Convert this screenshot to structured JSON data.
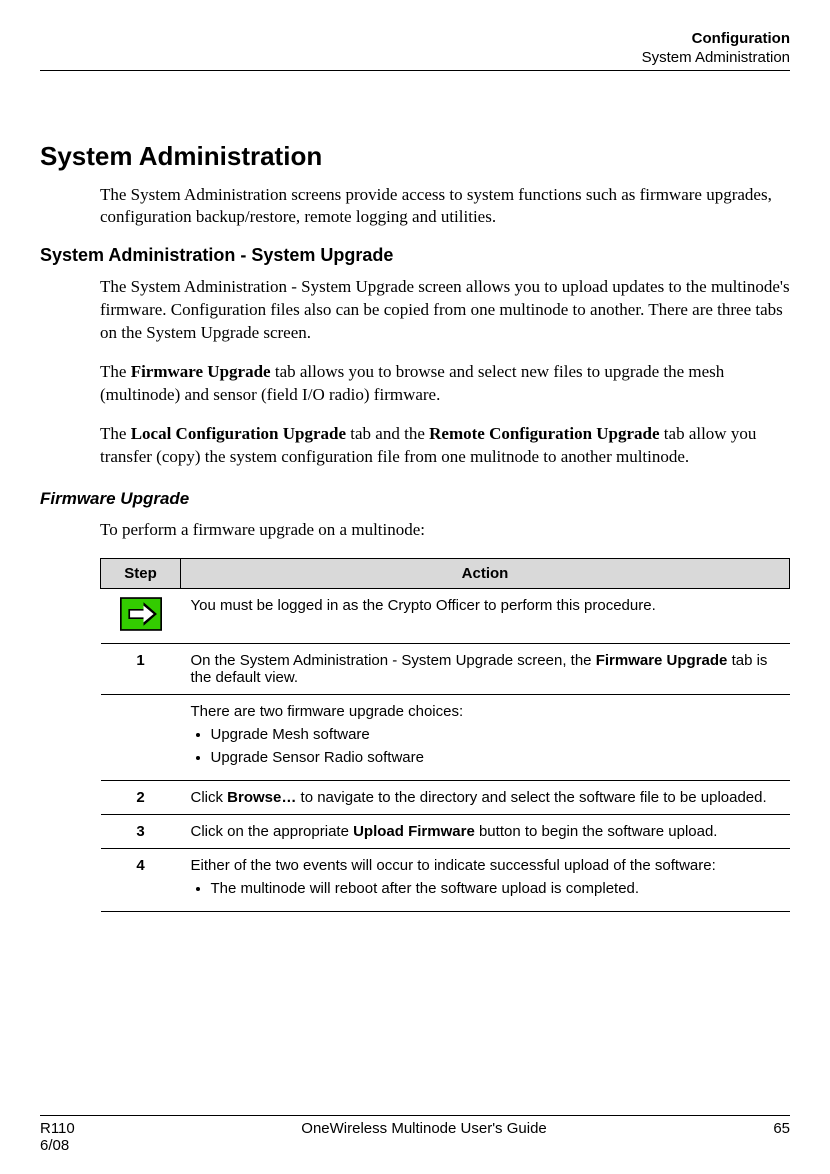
{
  "header": {
    "title": "Configuration",
    "subtitle": "System Administration"
  },
  "h1": "System Administration",
  "intro": "The System Administration screens provide access to system functions such as firmware upgrades, configuration backup/restore, remote logging and utilities.",
  "h2": "System Administration - System Upgrade",
  "p1": "The System Administration - System Upgrade screen allows you to upload updates to the multinode's firmware. Configuration files also can be copied from one multinode to another.  There are three tabs on the System Upgrade screen.",
  "p2_pre": "The ",
  "p2_b": "Firmware Upgrade",
  "p2_post": " tab allows you to browse and select new files to upgrade the mesh (multinode) and sensor (field I/O radio) firmware.",
  "p3_pre": "The ",
  "p3_b1": "Local Configuration Upgrade",
  "p3_mid": " tab and the ",
  "p3_b2": "Remote Configuration Upgrade",
  "p3_post": " tab allow you transfer (copy) the system configuration file from one mulitnode to another multinode.",
  "h3": "Firmware Upgrade",
  "p4": "To perform a firmware upgrade on a multinode:",
  "table": {
    "headers": {
      "step": "Step",
      "action": "Action"
    },
    "rows": {
      "note": "You must be logged in as the Crypto Officer to perform this procedure.",
      "r1": {
        "step": "1",
        "a_pre": "On the System Administration - System Upgrade screen, the ",
        "a_b": "Firmware Upgrade",
        "a_post": " tab is the default view."
      },
      "r1b": {
        "intro": "There are two firmware upgrade choices:",
        "b1": "Upgrade Mesh software",
        "b2": "Upgrade Sensor Radio software"
      },
      "r2": {
        "step": "2",
        "a_pre": "Click ",
        "a_b": "Browse…",
        "a_post": " to navigate to the directory and select the software file to be uploaded."
      },
      "r3": {
        "step": "3",
        "a_pre": "Click on the appropriate ",
        "a_b": "Upload Firmware",
        "a_post": " button to begin the software upload."
      },
      "r4": {
        "step": "4",
        "intro": "Either of the two events will occur to indicate successful upload of the software:",
        "b1": "The multinode will reboot after the software upload is completed."
      }
    }
  },
  "footer": {
    "rev": "R110",
    "date": "6/08",
    "doc": "OneWireless Multinode User's Guide",
    "page": "65"
  }
}
